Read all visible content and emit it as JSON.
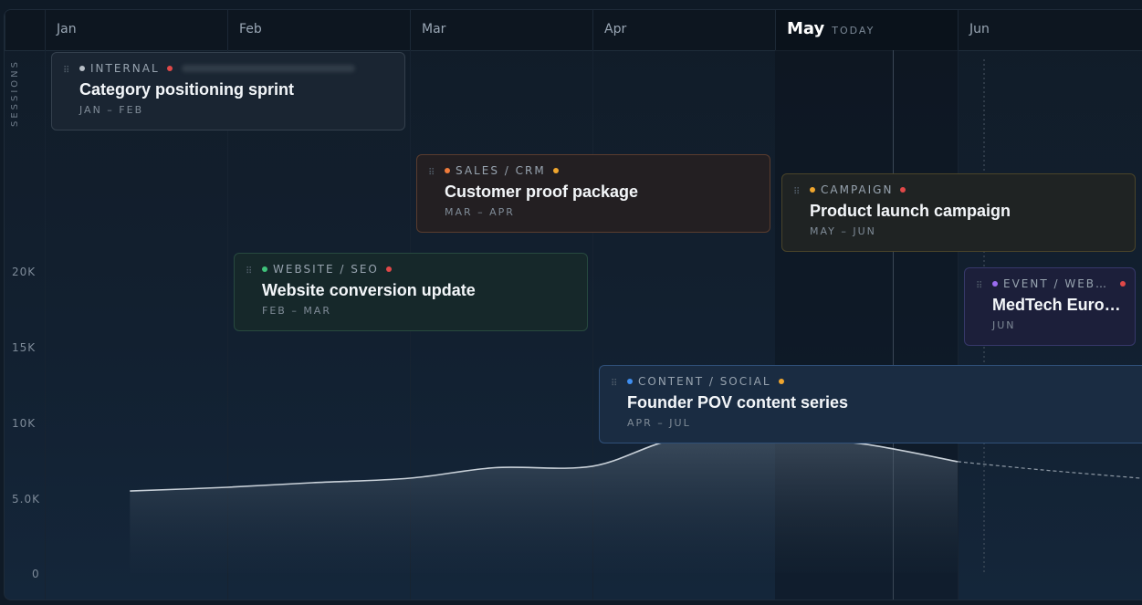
{
  "timeline": {
    "months": [
      "Jan",
      "Feb",
      "Mar",
      "Apr",
      "May",
      "Jun"
    ],
    "today_month": "May",
    "today_label": "TODAY"
  },
  "axis": {
    "title": "SESSIONS",
    "ticks": [
      "20K",
      "15K",
      "10K",
      "5.0K",
      "0"
    ]
  },
  "chart_data": {
    "type": "area",
    "x": [
      "Jan 15",
      "Feb 1",
      "Feb 15",
      "Mar 1",
      "Mar 15",
      "Apr 1",
      "Apr 15",
      "May 1",
      "May 15",
      "Jun 1",
      "Jun 15",
      "Jul 1"
    ],
    "series": [
      {
        "values": [
          5450,
          5700,
          6000,
          6300,
          7000,
          7100,
          8900,
          8900,
          8600,
          7400,
          6850,
          6300
        ]
      }
    ],
    "actual_through": "Jun 1",
    "forecast_from": "Jun 1",
    "ylabel": "SESSIONS",
    "ylim": [
      0,
      20000
    ]
  },
  "cards": [
    {
      "tag": "INTERNAL",
      "title": "Category positioning sprint",
      "range": "JAN – FEB",
      "dot": "#b8bfc7",
      "priority": "#e04848"
    },
    {
      "tag": "SALES / CRM",
      "title": "Customer proof package",
      "range": "MAR – APR",
      "dot": "#f07b3b",
      "priority": "#f0a62e"
    },
    {
      "tag": "CAMPAIGN",
      "title": "Product launch campaign",
      "range": "MAY – JUN",
      "dot": "#f0a62e",
      "priority": "#e04848"
    },
    {
      "tag": "WEBSITE / SEO",
      "title": "Website conversion update",
      "range": "FEB – MAR",
      "dot": "#3fc27a",
      "priority": "#e04848"
    },
    {
      "tag": "EVENT / WEB…",
      "title": "MedTech Euro…",
      "range": "JUN",
      "dot": "#9b6cf0",
      "priority": "#e04848"
    },
    {
      "tag": "CONTENT / SOCIAL",
      "title": "Founder POV content series",
      "range": "APR – JUL",
      "dot": "#3f8ef0",
      "priority": "#f0a62e"
    }
  ]
}
